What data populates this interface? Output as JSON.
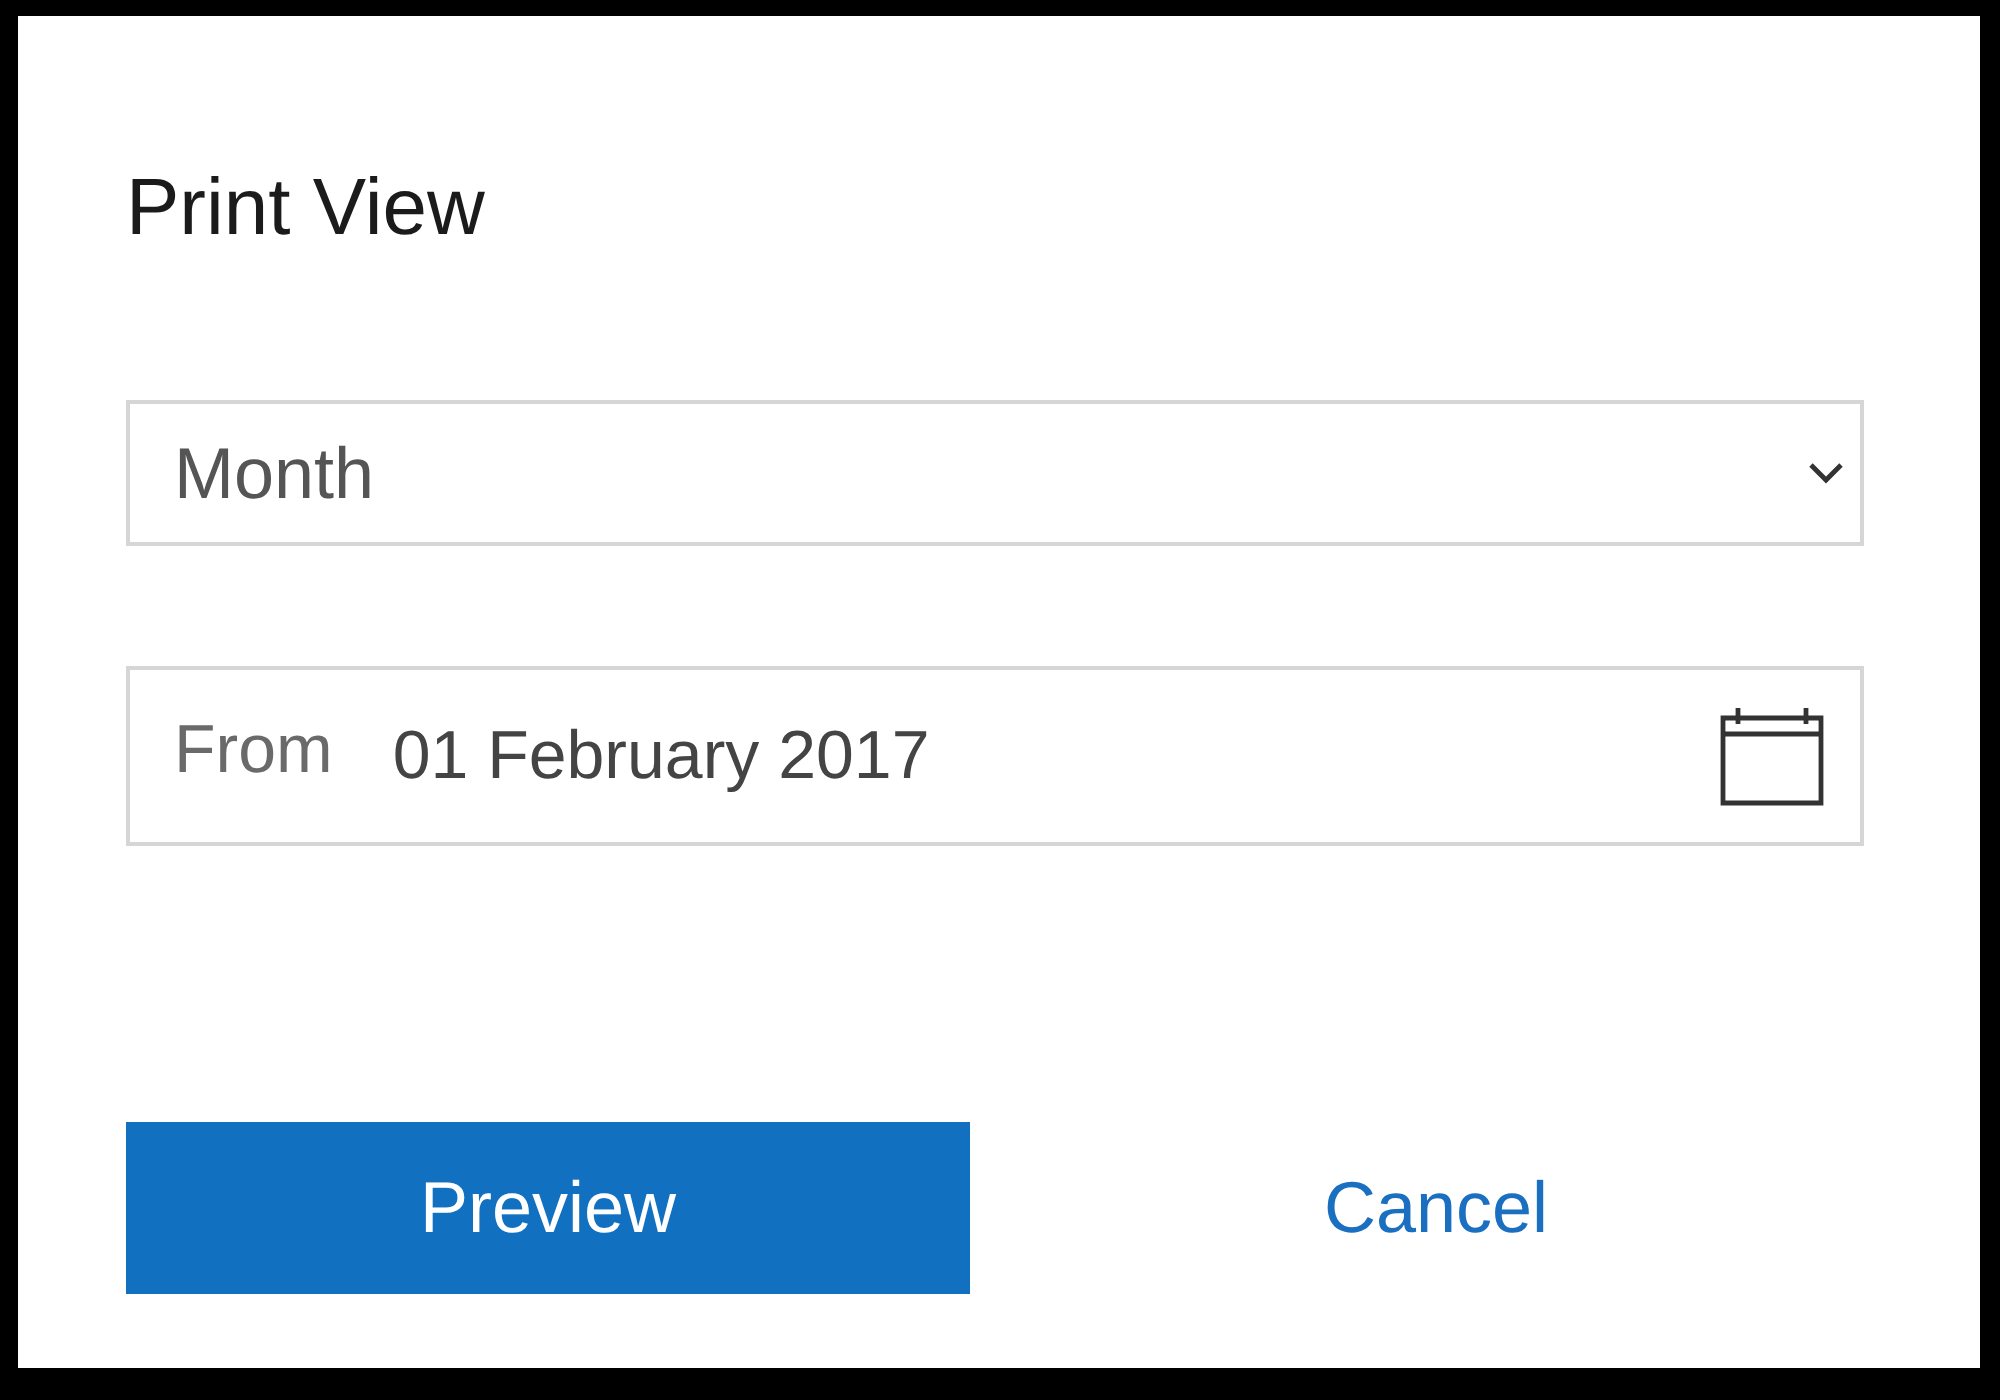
{
  "dialog": {
    "title": "Print View",
    "view_select": {
      "value": "Month"
    },
    "date_field": {
      "label": "From",
      "value": "01 February 2017"
    },
    "buttons": [
      {
        "label": "Preview",
        "kind": "primary"
      },
      {
        "label": "Cancel",
        "kind": "link"
      }
    ]
  }
}
